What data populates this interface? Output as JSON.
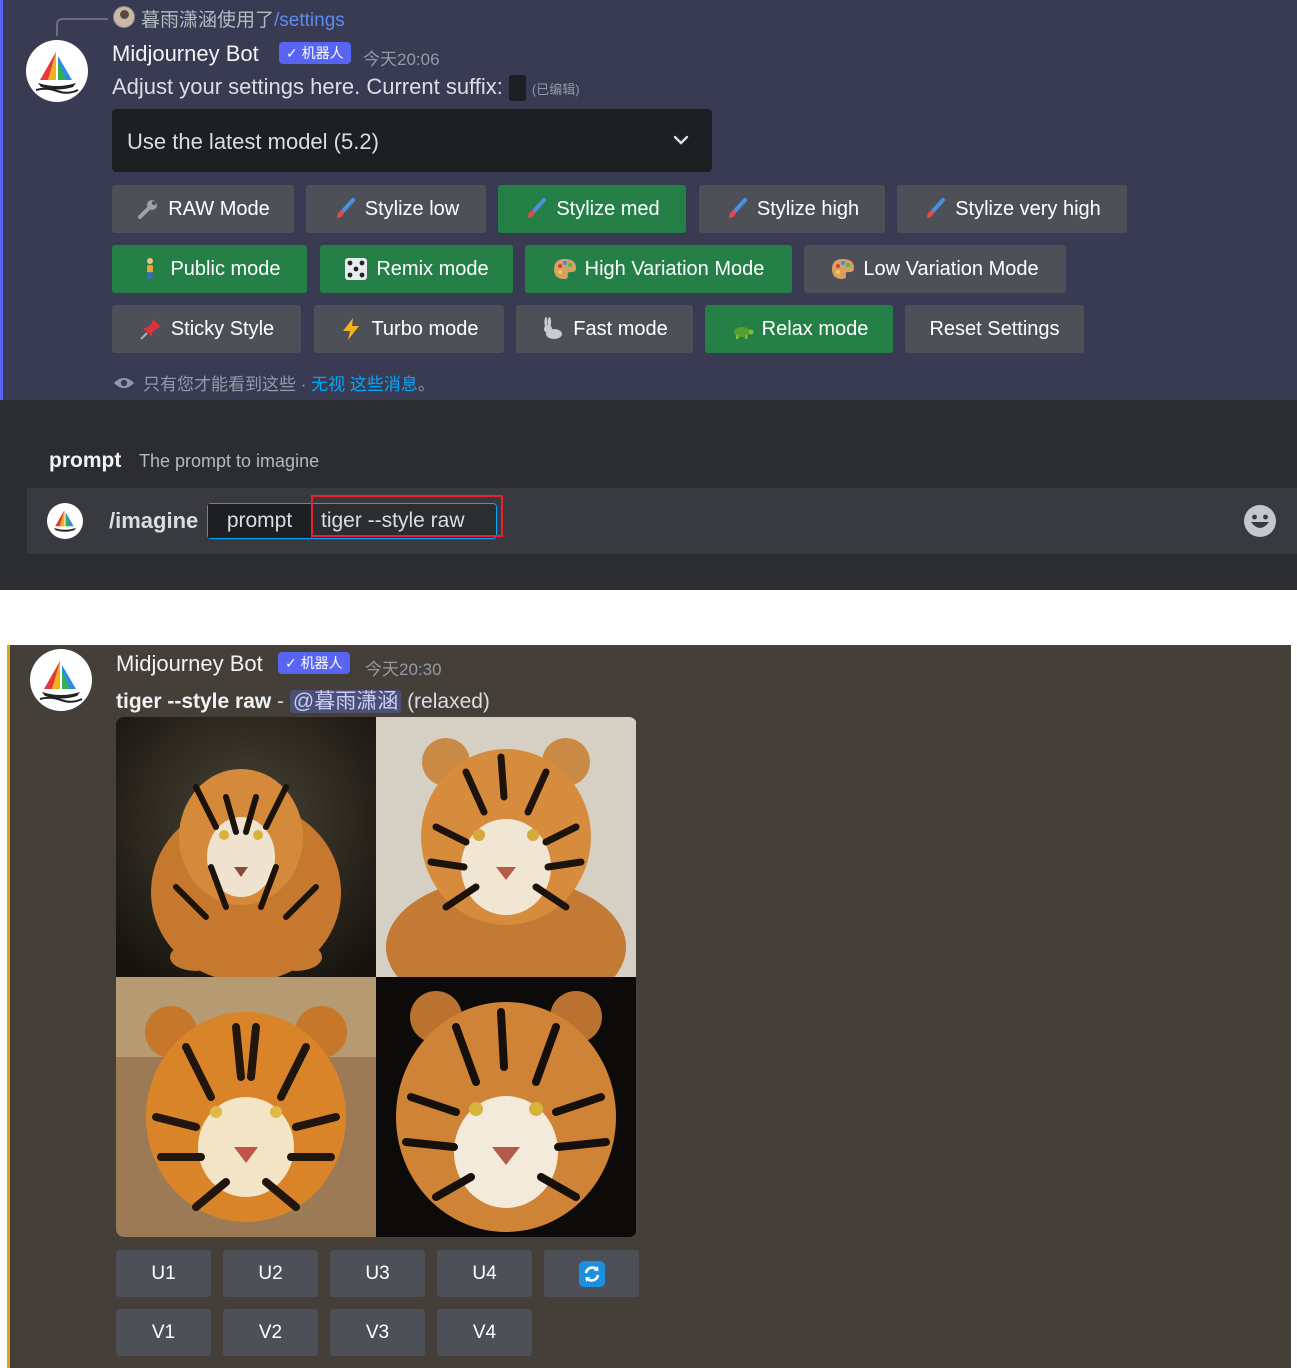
{
  "top_message": {
    "reply": {
      "user": "暮雨潇涵使用了",
      "command": "/settings"
    },
    "author": "Midjourney Bot",
    "bot_tag": "✓ 机器人",
    "timestamp": "今天20:06",
    "text": "Adjust your settings here. Current suffix:",
    "edited": "(已编辑)",
    "model_select": {
      "value": "Use the latest model (5.2)",
      "icon": "chevron-down-icon"
    },
    "buttons_row1": [
      {
        "label": "RAW Mode",
        "icon": "wrench-icon",
        "active": false
      },
      {
        "label": "Stylize low",
        "icon": "paintbrush-icon",
        "active": false
      },
      {
        "label": "Stylize med",
        "icon": "paintbrush-icon",
        "active": true
      },
      {
        "label": "Stylize high",
        "icon": "paintbrush-icon",
        "active": false
      },
      {
        "label": "Stylize very high",
        "icon": "paintbrush-icon",
        "active": false
      }
    ],
    "buttons_row2": [
      {
        "label": "Public mode",
        "icon": "person-icon",
        "active": true
      },
      {
        "label": "Remix mode",
        "icon": "dice-icon",
        "active": true
      },
      {
        "label": "High Variation Mode",
        "icon": "palette-icon",
        "active": true
      },
      {
        "label": "Low Variation Mode",
        "icon": "palette-icon",
        "active": false
      }
    ],
    "buttons_row3": [
      {
        "label": "Sticky Style",
        "icon": "pushpin-icon",
        "active": false
      },
      {
        "label": "Turbo mode",
        "icon": "lightning-icon",
        "active": false
      },
      {
        "label": "Fast mode",
        "icon": "rabbit-icon",
        "active": false
      },
      {
        "label": "Relax mode",
        "icon": "turtle-icon",
        "active": true
      },
      {
        "label": "Reset Settings",
        "icon": "",
        "active": false
      }
    ],
    "ephemeral": {
      "text": "只有您才能看到这些 · ",
      "dismiss": "无视 这些消息",
      "end": "。"
    }
  },
  "command_bar": {
    "option_name": "prompt",
    "option_desc": "The prompt to imagine",
    "command": "/imagine",
    "param_key": "prompt",
    "param_value": "tiger --style raw"
  },
  "bottom_message": {
    "author": "Midjourney Bot",
    "bot_tag": "✓ 机器人",
    "timestamp": "今天20:30",
    "prompt": "tiger --style raw",
    "separator": " - ",
    "mention": "@暮雨潇涵",
    "mode": "(relaxed)",
    "upscale_buttons": [
      "U1",
      "U2",
      "U3",
      "U4"
    ],
    "variation_buttons": [
      "V1",
      "V2",
      "V3",
      "V4"
    ],
    "reroll_icon": "refresh-icon"
  },
  "colors": {
    "accent": "#5865f2",
    "active_button": "#248046",
    "button": "#4e5058",
    "highlight_border": "#e8232f",
    "bottom_bg": "#443f38",
    "bottom_border": "#e0a31c"
  }
}
